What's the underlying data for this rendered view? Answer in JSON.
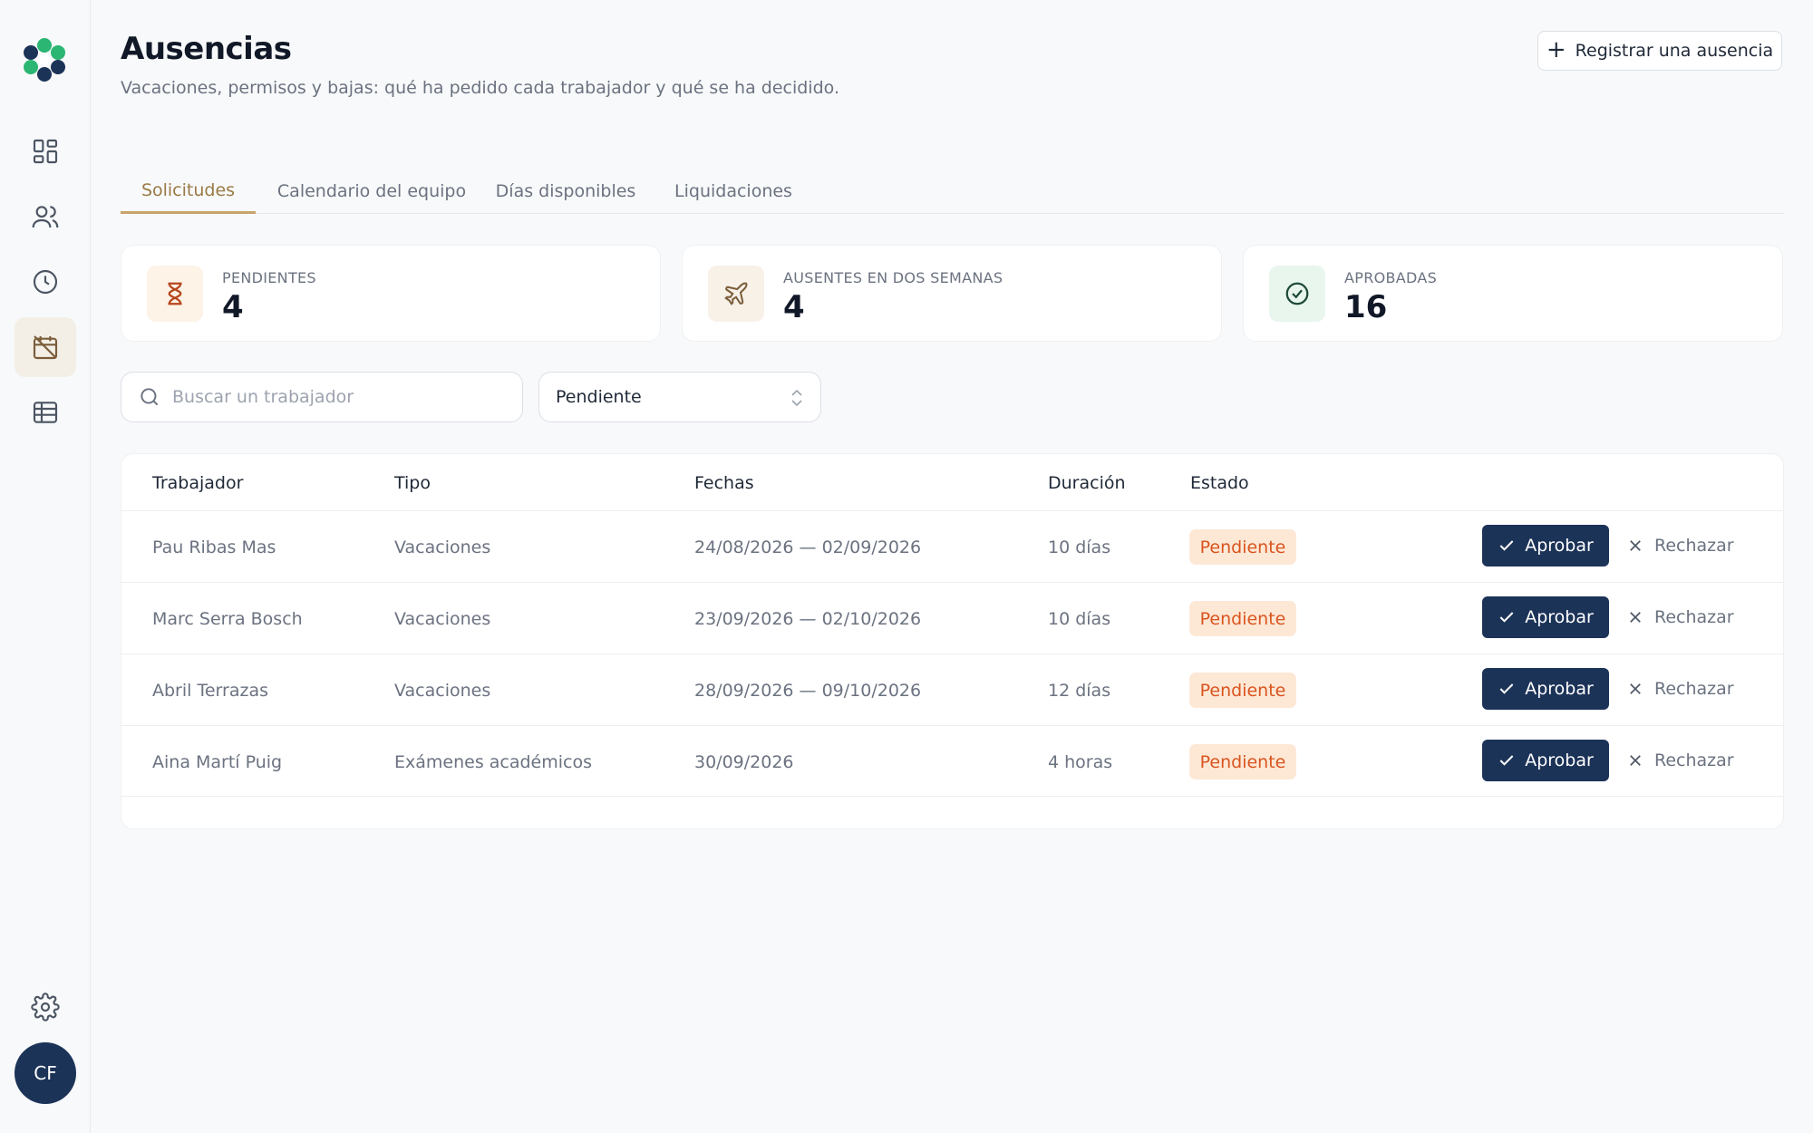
{
  "nav": {
    "items": [
      {
        "icon": "dashboard-icon"
      },
      {
        "icon": "users-icon"
      },
      {
        "icon": "clock-icon"
      },
      {
        "icon": "calendar-off-icon",
        "active": true
      },
      {
        "icon": "table-icon"
      }
    ],
    "settings_icon": "gear-icon",
    "avatar": "CF"
  },
  "header": {
    "title": "Ausencias",
    "subtitle": "Vacaciones, permisos y bajas: qué ha pedido cada trabajador y qué se ha decidido.",
    "register_button": "Registrar una ausencia"
  },
  "tabs": [
    "Solicitudes",
    "Calendario del equipo",
    "Días disponibles",
    "Liquidaciones"
  ],
  "active_tab": "Solicitudes",
  "stats": [
    {
      "label": "PENDIENTES",
      "value": "4",
      "icon": "hourglass-icon",
      "color": "#b5451b",
      "bg": "#fdf3e7"
    },
    {
      "label": "AUSENTES EN DOS SEMANAS",
      "value": "4",
      "icon": "plane-icon",
      "color": "#7a5c3a",
      "bg": "#f7f1e8"
    },
    {
      "label": "APROBADAS",
      "value": "16",
      "icon": "check-circle-icon",
      "color": "#1f7a4d",
      "bg": "#e8f6ee"
    }
  ],
  "filters": {
    "search_placeholder": "Buscar un trabajador",
    "status_selected": "Pendiente"
  },
  "table": {
    "headers": [
      "Trabajador",
      "Tipo",
      "Fechas",
      "Duración",
      "Estado"
    ],
    "rows": [
      {
        "worker": "Pau Ribas Mas",
        "type": "Vacaciones",
        "dates": "24/08/2026 — 02/09/2026",
        "duration": "10 días",
        "status": "Pendiente"
      },
      {
        "worker": "Marc Serra Bosch",
        "type": "Vacaciones",
        "dates": "23/09/2026 — 02/10/2026",
        "duration": "10 días",
        "status": "Pendiente"
      },
      {
        "worker": "Abril Terrazas",
        "type": "Vacaciones",
        "dates": "28/09/2026 — 09/10/2026",
        "duration": "12 días",
        "status": "Pendiente"
      },
      {
        "worker": "Aina Martí Puig",
        "type": "Exámenes académicos",
        "dates": "30/09/2026",
        "duration": "4 horas",
        "status": "Pendiente"
      }
    ],
    "approve_label": "Aprobar",
    "reject_label": "Rechazar"
  },
  "colors": {
    "accent": "#c8a46a",
    "primary": "#1c3358",
    "pending_bg": "#fde8d6",
    "pending_text": "#d9541e"
  }
}
